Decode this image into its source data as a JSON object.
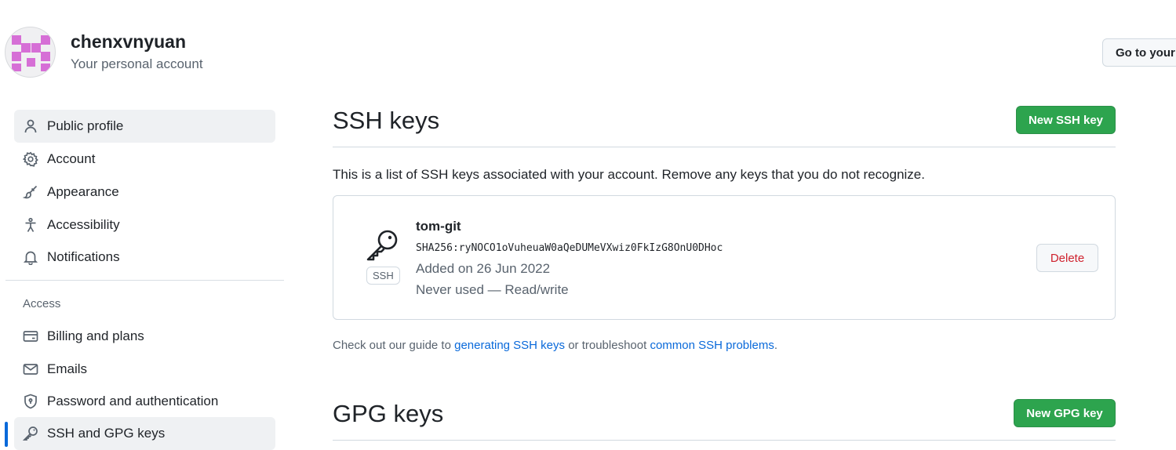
{
  "account": {
    "name": "chenxvnyuan",
    "subtitle": "Your personal account",
    "goto_button": "Go to your personal profile"
  },
  "sidebar": {
    "items": [
      {
        "label": "Public profile",
        "icon": "person-icon"
      },
      {
        "label": "Account",
        "icon": "gear-icon"
      },
      {
        "label": "Appearance",
        "icon": "paintbrush-icon"
      },
      {
        "label": "Accessibility",
        "icon": "accessibility-icon"
      },
      {
        "label": "Notifications",
        "icon": "bell-icon"
      }
    ],
    "section_label": "Access",
    "access_items": [
      {
        "label": "Billing and plans",
        "icon": "credit-card-icon"
      },
      {
        "label": "Emails",
        "icon": "mail-icon"
      },
      {
        "label": "Password and authentication",
        "icon": "shield-lock-icon"
      },
      {
        "label": "SSH and GPG keys",
        "icon": "key-icon"
      }
    ]
  },
  "ssh": {
    "title": "SSH keys",
    "new_button": "New SSH key",
    "description": "This is a list of SSH keys associated with your account. Remove any keys that you do not recognize.",
    "key": {
      "title": "tom-git",
      "fingerprint": "SHA256:ryNOCO1oVuheuaW0aQeDUMeVXwiz0FkIzG8OnU0DHoc",
      "added": "Added on 26 Jun 2022",
      "usage": "Never used — Read/write",
      "type_badge": "SSH",
      "delete_label": "Delete"
    },
    "help": {
      "prefix": "Check out our guide to ",
      "link1": "generating SSH keys",
      "middle": " or troubleshoot ",
      "link2": "common SSH problems",
      "suffix": "."
    }
  },
  "gpg": {
    "title": "GPG keys",
    "new_button": "New GPG key"
  },
  "colors": {
    "primary_button": "#2da44e",
    "link": "#0969da",
    "danger": "#cf222e",
    "active_indicator": "#0969da",
    "avatar_identicon": "#d66fd6"
  }
}
